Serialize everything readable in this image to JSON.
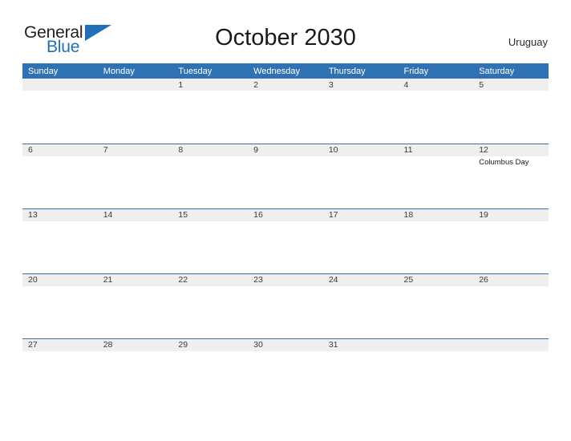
{
  "brand": {
    "name_top": "General",
    "name_bottom": "Blue",
    "flag_icon": "blue-flag-triangle",
    "color_dark": "#231f20",
    "color_blue": "#1f70b8"
  },
  "header": {
    "title": "October 2030",
    "region": "Uruguay"
  },
  "theme": {
    "header_blue": "#2e72b4",
    "band_gray": "#efefef",
    "page_background": "#ffffff",
    "text_dark": "#3a3a3a"
  },
  "calendar": {
    "month": "October",
    "year": "2030",
    "weekday_headers": [
      "Sunday",
      "Monday",
      "Tuesday",
      "Wednesday",
      "Thursday",
      "Friday",
      "Saturday"
    ],
    "weeks": [
      [
        {
          "day": "",
          "event": ""
        },
        {
          "day": "",
          "event": ""
        },
        {
          "day": "1",
          "event": ""
        },
        {
          "day": "2",
          "event": ""
        },
        {
          "day": "3",
          "event": ""
        },
        {
          "day": "4",
          "event": ""
        },
        {
          "day": "5",
          "event": ""
        }
      ],
      [
        {
          "day": "6",
          "event": ""
        },
        {
          "day": "7",
          "event": ""
        },
        {
          "day": "8",
          "event": ""
        },
        {
          "day": "9",
          "event": ""
        },
        {
          "day": "10",
          "event": ""
        },
        {
          "day": "11",
          "event": ""
        },
        {
          "day": "12",
          "event": "Columbus Day"
        }
      ],
      [
        {
          "day": "13",
          "event": ""
        },
        {
          "day": "14",
          "event": ""
        },
        {
          "day": "15",
          "event": ""
        },
        {
          "day": "16",
          "event": ""
        },
        {
          "day": "17",
          "event": ""
        },
        {
          "day": "18",
          "event": ""
        },
        {
          "day": "19",
          "event": ""
        }
      ],
      [
        {
          "day": "20",
          "event": ""
        },
        {
          "day": "21",
          "event": ""
        },
        {
          "day": "22",
          "event": ""
        },
        {
          "day": "23",
          "event": ""
        },
        {
          "day": "24",
          "event": ""
        },
        {
          "day": "25",
          "event": ""
        },
        {
          "day": "26",
          "event": ""
        }
      ],
      [
        {
          "day": "27",
          "event": ""
        },
        {
          "day": "28",
          "event": ""
        },
        {
          "day": "29",
          "event": ""
        },
        {
          "day": "30",
          "event": ""
        },
        {
          "day": "31",
          "event": ""
        },
        {
          "day": "",
          "event": ""
        },
        {
          "day": "",
          "event": ""
        }
      ]
    ]
  }
}
